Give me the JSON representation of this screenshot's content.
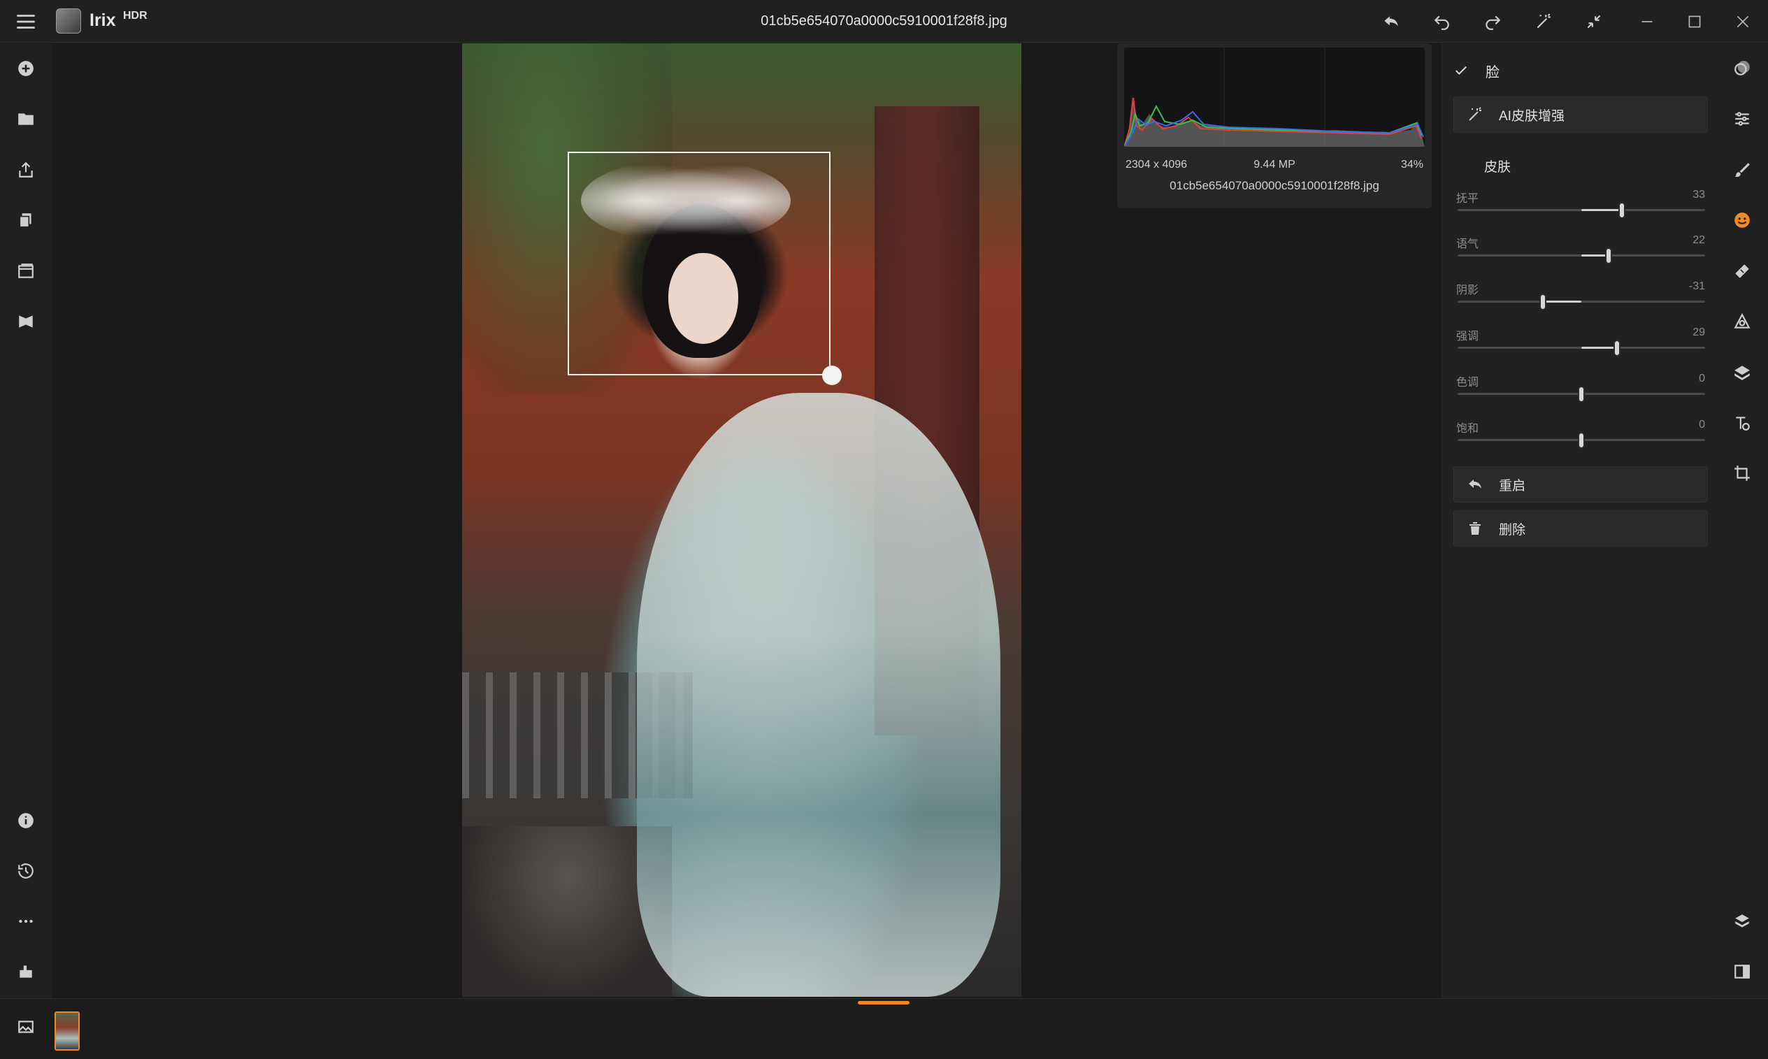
{
  "app": {
    "name": "Irix",
    "edition": "HDR"
  },
  "window": {
    "title": "01cb5e654070a0000c5910001f28f8.jpg"
  },
  "histogram": {
    "dimensions": "2304 x 4096",
    "megapixels": "9.44 MP",
    "zoom": "34%",
    "filename": "01cb5e654070a0000c5910001f28f8.jpg"
  },
  "panel": {
    "section_title": "脸",
    "ai_button": "AI皮肤增强",
    "group_title": "皮肤",
    "sliders": [
      {
        "label": "抚平",
        "value": 33
      },
      {
        "label": "语气",
        "value": 22
      },
      {
        "label": "阴影",
        "value": -31
      },
      {
        "label": "强调",
        "value": 29
      },
      {
        "label": "色调",
        "value": 0
      },
      {
        "label": "饱和",
        "value": 0
      }
    ],
    "reset_button": "重启",
    "delete_button": "删除"
  },
  "filmstrip": {
    "progress": 1.0
  },
  "colors": {
    "accent": "#f08a24",
    "panel": "#212121",
    "canvas": "#1a1a1a"
  },
  "icons": {
    "titlebar": [
      "menu-icon",
      "undo-all-icon",
      "undo-icon",
      "redo-icon",
      "auto-enhance-icon",
      "compare-icon",
      "minimize-icon",
      "maximize-icon",
      "close-icon"
    ],
    "left": [
      "add-icon",
      "folder-icon",
      "export-icon",
      "batch-icon",
      "windows-icon",
      "flag-icon",
      "info-icon",
      "history-icon",
      "more-icon",
      "hand-icon"
    ],
    "right": [
      "presets-icon",
      "adjust-icon",
      "brush-icon",
      "face-icon",
      "healing-icon",
      "shapes-icon",
      "layers-icon",
      "text-icon",
      "crop-icon",
      "stack-icon",
      "panel-toggle-icon"
    ]
  }
}
